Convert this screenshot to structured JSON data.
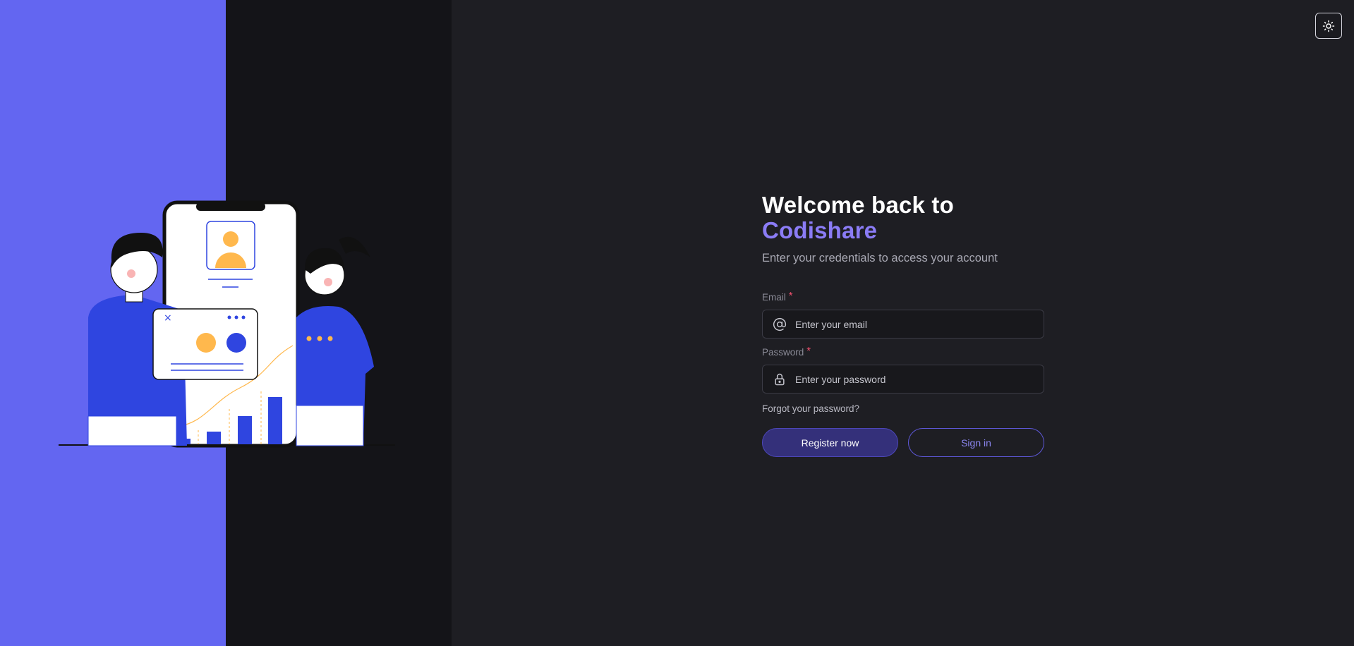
{
  "theme_toggle": {
    "icon": "sun-icon"
  },
  "heading": {
    "line1": "Welcome back to",
    "brand": "Codishare",
    "subtitle": "Enter your credentials to access your account"
  },
  "email": {
    "label": "Email",
    "required_mark": "*",
    "placeholder": "Enter your email",
    "value": "",
    "icon": "at-sign-icon"
  },
  "password": {
    "label": "Password",
    "required_mark": "*",
    "placeholder": "Enter your password",
    "value": "",
    "icon": "lock-icon"
  },
  "forgot_link": "Forgot your password?",
  "buttons": {
    "register": "Register now",
    "signin": "Sign in"
  },
  "colors": {
    "accent": "#6366f1",
    "brand_text": "#8b7cf6",
    "background": "#1e1e23",
    "required": "#f0506e"
  }
}
